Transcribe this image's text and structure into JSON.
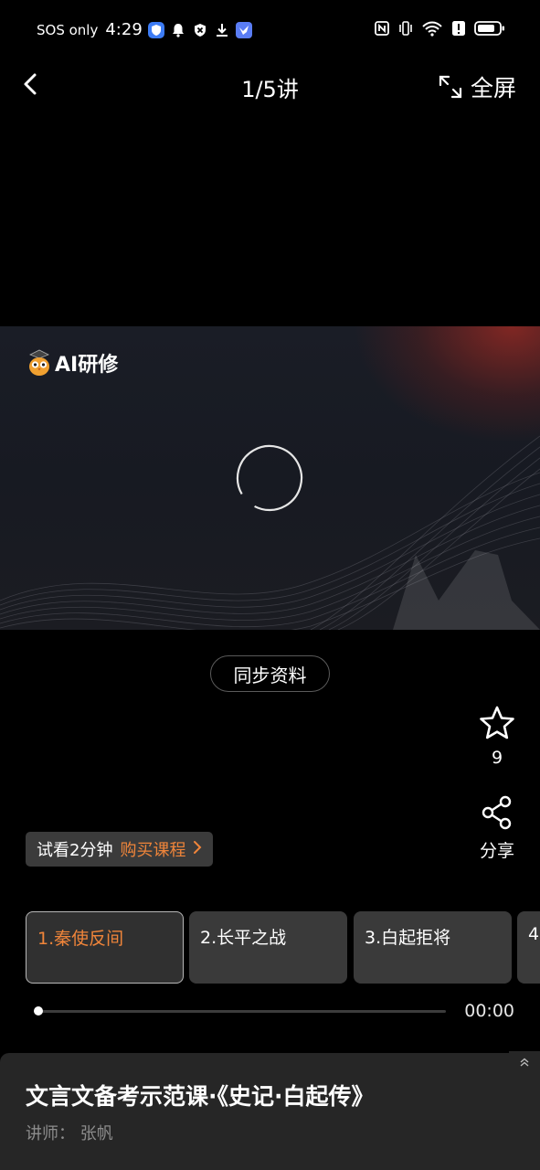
{
  "status_bar": {
    "carrier": "SOS only",
    "time": "4:29",
    "left_icons": [
      "shield-app-icon",
      "notification-bell-icon",
      "x-circle-icon",
      "download-icon",
      "bird-app-icon"
    ],
    "right_icons": [
      "nfc-icon",
      "vibrate-icon",
      "wifi-6-icon",
      "alert-icon",
      "battery-icon"
    ],
    "wifi_label": "6"
  },
  "nav": {
    "title": "1/5讲",
    "fullscreen_label": "全屏"
  },
  "video": {
    "logo_text": "AI研修",
    "state": "loading"
  },
  "sync_button": "同步资料",
  "actions": {
    "favorite_count": "9",
    "share_label": "分享"
  },
  "trial": {
    "text": "试看2分钟",
    "buy_label": "购买课程"
  },
  "episodes": [
    {
      "label": "1.秦使反间",
      "active": true
    },
    {
      "label": "2.长平之战",
      "active": false
    },
    {
      "label": "3.白起拒将",
      "active": false
    },
    {
      "label": "4",
      "active": false
    }
  ],
  "player": {
    "current_time": "00:00"
  },
  "course": {
    "title": "文言文备考示范课·《史记·白起传》",
    "teacher": "讲师：  张帆"
  },
  "colors": {
    "accent": "#f0853a",
    "background": "#000000",
    "sheet": "#262626"
  }
}
